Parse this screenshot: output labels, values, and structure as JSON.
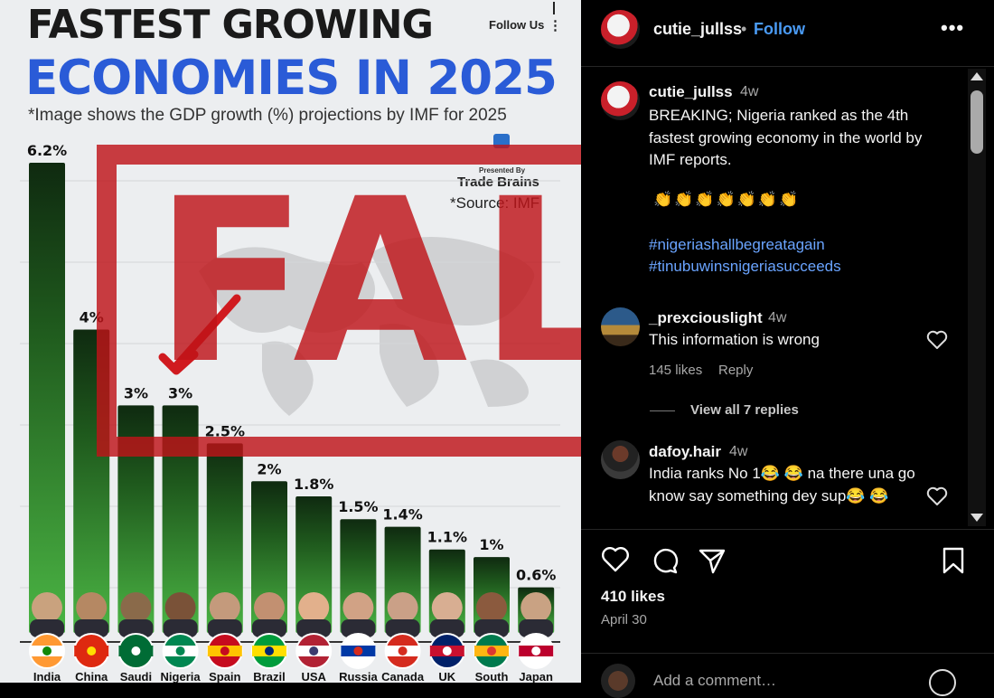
{
  "infographic": {
    "title_line1": "FASTEST GROWING",
    "title_line2": "ECONOMIES IN 2025",
    "subtitle": "*Image shows the GDP growth (%) projections by IMF for 2025",
    "follow_label": "Follow Us",
    "brand_small": "Presented By",
    "brand_name": "Trade Brains",
    "source": "*Source: IMF",
    "stamp_text": "FALSE",
    "colors": {
      "title_blue": "#2a5bd7",
      "bar_green": "#3f9b3a",
      "bar_dark": "#0f2a10",
      "stamp_red": "#be1419"
    }
  },
  "chart_data": {
    "type": "bar",
    "title": "FASTEST GROWING ECONOMIES IN 2025",
    "categories": [
      "India",
      "China",
      "Saudi",
      "Nigeria",
      "Spain",
      "Brazil",
      "USA",
      "Russia",
      "Canada",
      "UK",
      "South",
      "Japan"
    ],
    "values": [
      6.2,
      4,
      3,
      3,
      2.5,
      2,
      1.8,
      1.5,
      1.4,
      1.1,
      1,
      0.6
    ],
    "value_labels": [
      "6.2%",
      "4%",
      "3%",
      "3%",
      "2.5%",
      "2%",
      "1.8%",
      "1.5%",
      "1.4%",
      "1.1%",
      "1%",
      "0.6%"
    ],
    "ylabel": "",
    "xlabel": "",
    "ylim": [
      0,
      6.2
    ],
    "legend": "none",
    "highlight": "Nigeria"
  },
  "post": {
    "header": {
      "username": "cutie_jullss",
      "follow_label": "Follow",
      "more_icon": "more-horizontal-icon"
    },
    "caption": {
      "username": "cutie_jullss",
      "time": "4w",
      "text": "BREAKING; Nigeria ranked as the 4th fastest growing economy in the world by IMF reports.",
      "emojis": "👏👏👏👏👏👏👏",
      "hashtags": [
        "#nigeriashallbegreatagain",
        "#tinubuwinsnigeriasucceeds"
      ]
    },
    "comments": [
      {
        "username": "_prexciouslight",
        "time": "4w",
        "text": "This information is wrong",
        "likes": "145 likes",
        "reply_label": "Reply",
        "view_replies": "View all 7 replies"
      },
      {
        "username": "dafoy.hair",
        "time": "4w",
        "text": "India ranks No 1😂 😂 na there una go know say something dey sup😂 😂"
      }
    ],
    "likes": "410 likes",
    "date": "April 30",
    "add_comment_placeholder": "Add a comment…"
  }
}
